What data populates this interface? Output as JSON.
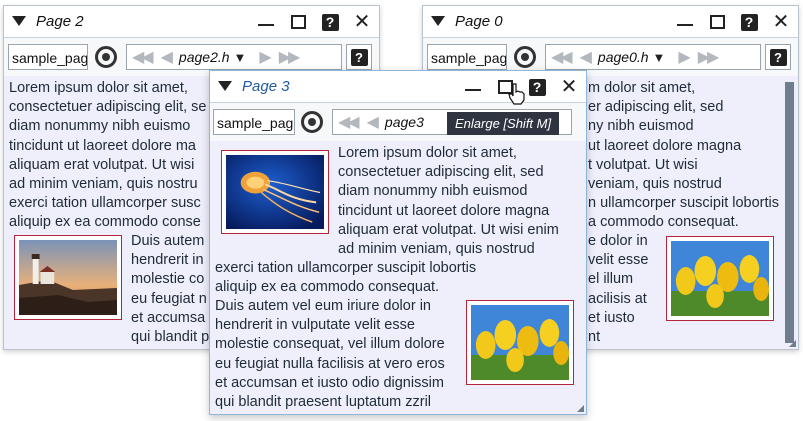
{
  "lorem": {
    "p1": [
      "Lorem ipsum dolor sit amet,",
      "consectetuer adipiscing elit, sed",
      "diam nonummy nibh euismod",
      "tincidunt ut laoreet dolore magna",
      "aliquam erat volutpat. Ut wisi enim",
      "ad minim veniam, quis nostrud",
      "exerci tation ullamcorper suscipit lobortis",
      "aliquip ex ea commodo consequat."
    ],
    "p2": [
      "Duis autem vel eum iriure dolor in",
      "hendrerit in vulputate velit esse",
      "molestie consequat, vel illum dolore",
      "eu feugiat nulla facilisis at vero eros",
      "et accumsan et iusto odio dignissim",
      "qui blandit praesent luptatum zzril"
    ]
  },
  "window_page2": {
    "title": "Page 2",
    "file_field": "sample_pag",
    "page_label": "page2.h",
    "p1": [
      "Lorem ipsum dolor sit amet,",
      "consectetuer adipiscing elit, se",
      "diam nonummy nibh euismo",
      "tincidunt ut laoreet dolore ma",
      "aliquam erat volutpat. Ut wisi",
      "ad minim veniam, quis nostru",
      "exerci tation ullamcorper susc",
      "aliquip ex ea commodo conse"
    ],
    "p2": [
      "Duis autem",
      "hendrerit in",
      "molestie co",
      "eu feugiat n",
      "et accumsa",
      "qui blandit p"
    ]
  },
  "window_page0": {
    "title": "Page 0",
    "file_field": "sample_pag",
    "page_label": "page0.h",
    "p1": [
      "m dolor sit amet,",
      "er adipiscing elit, sed",
      "ny nibh euismod",
      "ut laoreet dolore magna",
      "t volutpat. Ut wisi",
      "veniam, quis nostrud",
      "n ullamcorper suscipit lobortis",
      "a commodo consequat."
    ],
    "p2": [
      "e dolor in",
      "velit esse",
      "el illum",
      "acilisis at",
      "et iusto",
      "nt"
    ]
  },
  "window_page3": {
    "title": "Page 3",
    "file_field": "sample_pag",
    "page_label": "page3"
  },
  "tooltip": "Enlarge [Shift M]",
  "icons": {
    "collapse": "triangle-down-icon",
    "minimize": "minimize-icon",
    "maximize": "maximize-icon",
    "help": "help-icon",
    "close": "close-icon",
    "sync": "sync-icon",
    "first": "first-page-icon",
    "prev": "prev-page-icon",
    "next": "next-page-icon",
    "last": "last-page-icon"
  },
  "colors": {
    "content_bg": "#efeffb",
    "image_border": "#b3263a",
    "active_title": "#1f5a9a"
  }
}
